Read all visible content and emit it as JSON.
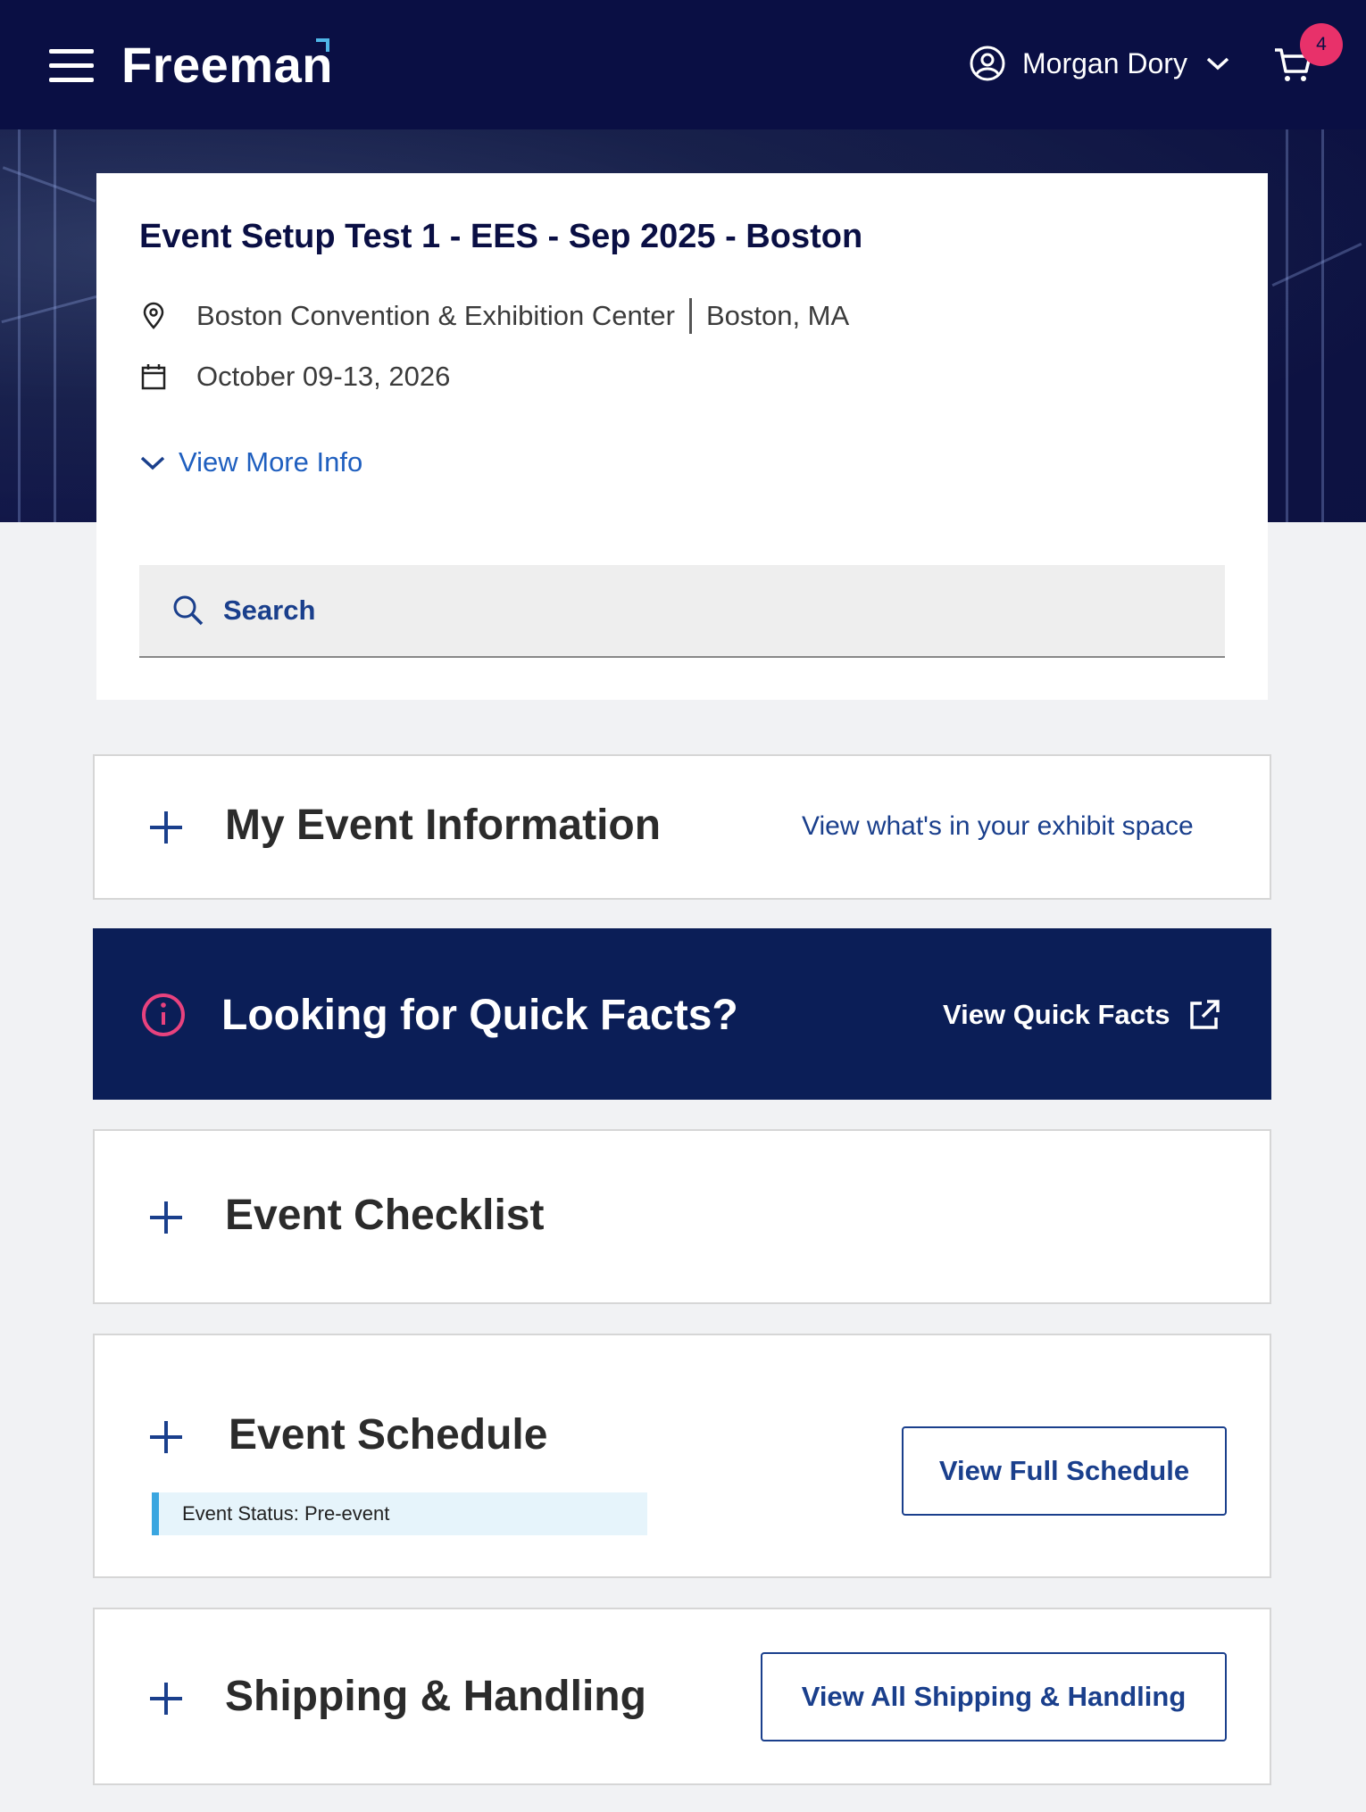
{
  "header": {
    "logo_text": "Freeman",
    "user_name": "Morgan Dory",
    "cart_count": "4",
    "background_color": "#0a0f44",
    "badge_color": "#e8316a"
  },
  "event": {
    "title": "Event Setup Test 1 - EES - Sep 2025 - Boston",
    "venue": "Boston Convention & Exhibition Center",
    "city": "Boston, MA",
    "dates": "October 09-13, 2026",
    "more_info_label": "View More Info"
  },
  "search": {
    "placeholder": "Search"
  },
  "sections": {
    "my_event": {
      "title": "My Event Information",
      "link": "View what's in your exhibit space"
    },
    "quick_facts": {
      "title": "Looking for Quick Facts?",
      "link": "View Quick Facts",
      "background_color": "#0b1e57",
      "icon_color": "#e8427e"
    },
    "checklist": {
      "title": "Event Checklist"
    },
    "schedule": {
      "title": "Event Schedule",
      "status": "Event Status: Pre-event",
      "button": "View Full Schedule"
    },
    "shipping": {
      "title": "Shipping & Handling",
      "button": "View All Shipping & Handling"
    }
  },
  "icons": {
    "menu": "hamburger-icon",
    "user": "user-circle-icon",
    "dropdown": "chevron-down-icon",
    "cart": "cart-icon",
    "location": "map-pin-icon",
    "calendar": "calendar-icon",
    "search": "search-icon",
    "expand": "plus-icon",
    "info": "info-icon",
    "external": "external-link-icon"
  }
}
